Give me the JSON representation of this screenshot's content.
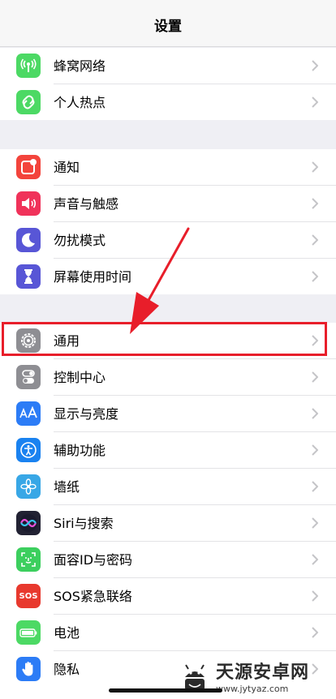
{
  "nav": {
    "title": "设置"
  },
  "groups": [
    {
      "items": [
        {
          "label": "蜂窝网络",
          "icon": "antenna-icon",
          "color": "#4cd964"
        },
        {
          "label": "个人热点",
          "icon": "hotspot-icon",
          "color": "#4cd964"
        }
      ]
    },
    {
      "items": [
        {
          "label": "通知",
          "icon": "notification-icon",
          "color": "#f3443c"
        },
        {
          "label": "声音与触感",
          "icon": "speaker-icon",
          "color": "#f0325a"
        },
        {
          "label": "勿扰模式",
          "icon": "moon-icon",
          "color": "#5856d6"
        },
        {
          "label": "屏幕使用时间",
          "icon": "hourglass-icon",
          "color": "#5856d6"
        }
      ]
    },
    {
      "items": [
        {
          "label": "通用",
          "icon": "gear-icon",
          "color": "#8e8e93"
        },
        {
          "label": "控制中心",
          "icon": "toggles-icon",
          "color": "#8e8e93"
        },
        {
          "label": "显示与亮度",
          "icon": "text-size-icon",
          "color": "#2c7cf6"
        },
        {
          "label": "辅助功能",
          "icon": "accessibility-icon",
          "color": "#1a82f0"
        },
        {
          "label": "墙纸",
          "icon": "flower-icon",
          "color": "#38a7e6"
        },
        {
          "label": "Siri与搜索",
          "icon": "siri-icon",
          "color": "#222233"
        },
        {
          "label": "面容ID与密码",
          "icon": "faceid-icon",
          "color": "#3ccf5e"
        },
        {
          "label": "SOS紧急联络",
          "icon": "sos-icon",
          "color": "#e8392e",
          "icon_text": "SOS"
        },
        {
          "label": "电池",
          "icon": "battery-icon",
          "color": "#4cd964"
        },
        {
          "label": "隐私",
          "icon": "hand-icon",
          "color": "#2c7cf6"
        }
      ]
    }
  ],
  "annotation": {
    "box_color": "#e81e2a",
    "arrow_color": "#e81e2a"
  },
  "watermark": {
    "title": "天源安卓网",
    "url": "www.jytyaz.com"
  }
}
